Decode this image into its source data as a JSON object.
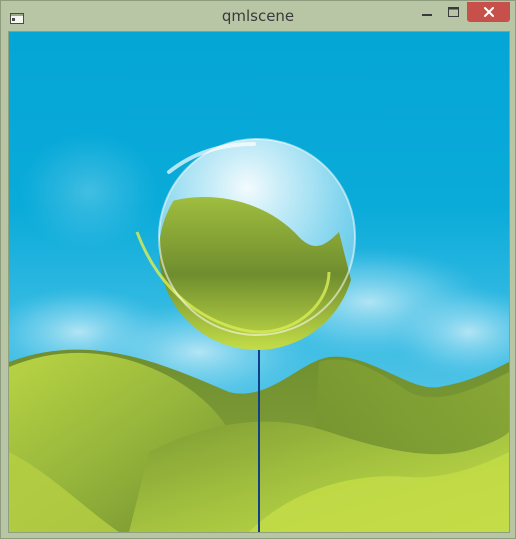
{
  "window": {
    "title": "qmlscene",
    "icons": {
      "app": "window-app-icon",
      "minimize": "minimize-icon",
      "maximize": "maximize-icon",
      "close": "close-icon"
    },
    "colors": {
      "frame": "#b8c6a6",
      "close_button": "#c7504a",
      "sky": "#05a7d6",
      "hills": "#8aa83a",
      "string": "#0f3f8a"
    }
  }
}
